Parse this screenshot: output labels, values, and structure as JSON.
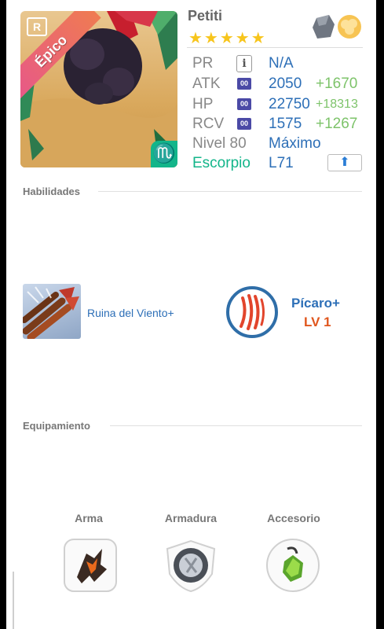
{
  "colors": {
    "accent_blue": "#2d6fb7",
    "bonus_green": "#7dc36a",
    "level_orange": "#e0561d",
    "star_yellow": "#f7c51c",
    "stat_badge": "#4b4aa6"
  },
  "monster": {
    "name": "Petiti",
    "rarity": "Épico",
    "rarity_icon": "R",
    "stars": "★★★★★",
    "zodiac_symbol": "♏",
    "elements": [
      "stone-element-icon",
      "cloud-element-icon"
    ]
  },
  "stats": {
    "pr": {
      "label": "PR",
      "badge": "i",
      "value": "N/A"
    },
    "atk": {
      "label": "ATK",
      "badge": "00",
      "value": "2050",
      "bonus": "+1670"
    },
    "hp": {
      "label": "HP",
      "badge": "00",
      "value": "22750",
      "bonus": "+18313"
    },
    "rcv": {
      "label": "RCV",
      "badge": "00",
      "value": "1575",
      "bonus": "+1267"
    },
    "level": {
      "label": "Nivel 80",
      "value": "Máximo"
    },
    "sign": {
      "label": "Escorpio",
      "value": "L71",
      "button_icon": "⬆"
    }
  },
  "skills": {
    "title": "Habilidades",
    "active": {
      "name": "Ruina del Viento+"
    },
    "leader": {
      "name": "Pícaro+",
      "level": "LV 1"
    }
  },
  "equipment": {
    "title": "Equipamiento",
    "slots": [
      {
        "label": "Arma"
      },
      {
        "label": "Armadura"
      },
      {
        "label": "Accesorio"
      }
    ]
  }
}
